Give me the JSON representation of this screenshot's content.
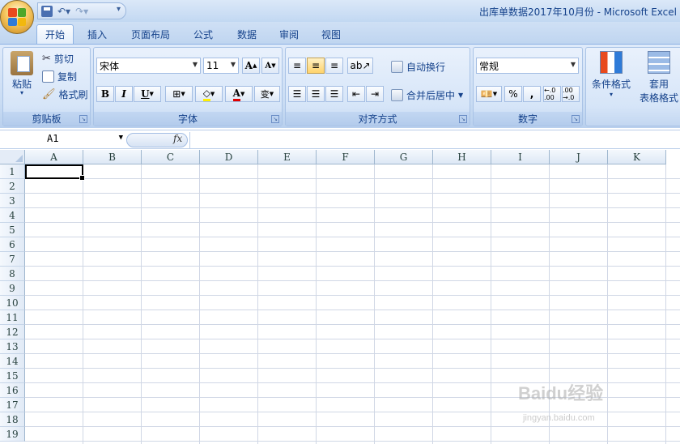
{
  "window": {
    "title": "出库单数据2017年10月份 - Microsoft Excel"
  },
  "tabs": [
    {
      "label": "开始",
      "active": true
    },
    {
      "label": "插入"
    },
    {
      "label": "页面布局"
    },
    {
      "label": "公式"
    },
    {
      "label": "数据"
    },
    {
      "label": "审阅"
    },
    {
      "label": "视图"
    }
  ],
  "clipboard": {
    "paste": "粘贴",
    "cut": "剪切",
    "copy": "复制",
    "format_painter": "格式刷",
    "group": "剪贴板"
  },
  "font": {
    "name": "宋体",
    "size": "11",
    "bold": "B",
    "italic": "I",
    "underline": "U",
    "group": "字体"
  },
  "alignment": {
    "wrap_text": "自动换行",
    "merge_center": "合并后居中",
    "group": "对齐方式"
  },
  "number": {
    "format": "常规",
    "percent": "%",
    "comma": ",",
    "increase_decimal": "←.0 .00",
    "decrease_decimal": ".00 →.0",
    "group": "数字"
  },
  "styles": {
    "conditional_format": "条件格式",
    "table_format_line1": "套用",
    "table_format_line2": "表格格式"
  },
  "formula_bar": {
    "name_box": "A1",
    "fx": "fx",
    "formula": ""
  },
  "sheet": {
    "columns": [
      "A",
      "B",
      "C",
      "D",
      "E",
      "F",
      "G",
      "H",
      "I",
      "J",
      "K"
    ],
    "rows": [
      "1",
      "2",
      "3",
      "4",
      "5",
      "6",
      "7",
      "8",
      "9",
      "10",
      "11",
      "12",
      "13",
      "14",
      "15",
      "16",
      "17",
      "18",
      "19"
    ],
    "selected_cell": "A1"
  },
  "watermark": {
    "brand": "Baidu经验",
    "url": "jingyan.baidu.com"
  },
  "colors": {
    "ribbon": "#c9dcf3",
    "accent": "#15428b",
    "selection": "#ffd36b"
  }
}
